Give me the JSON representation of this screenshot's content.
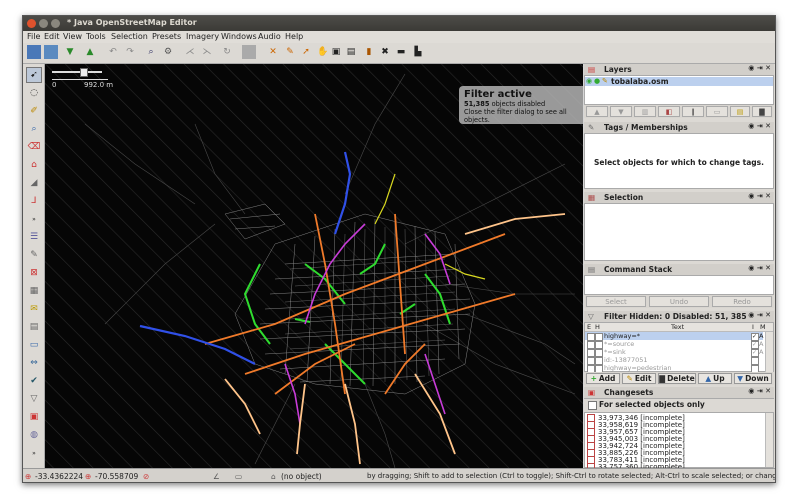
{
  "window_title": "* Java OpenStreetMap Editor",
  "menu": [
    "File",
    "Edit",
    "View",
    "Tools",
    "Selection",
    "Presets",
    "Imagery",
    "Windows",
    "Audio",
    "Help"
  ],
  "scale_label": "992.0 m",
  "scale_zero": "0",
  "filter_overlay": {
    "title": "Filter active",
    "count": "51,385",
    "line1_suffix": "objects disabled",
    "line2": "Close the filter dialog to see all objects."
  },
  "layers": {
    "title": "Layers",
    "items": [
      {
        "name": "tobalaba.osm"
      }
    ]
  },
  "tags": {
    "title": "Tags / Memberships",
    "hint": "Select objects for which to change tags."
  },
  "selection": {
    "title": "Selection"
  },
  "command_stack": {
    "title": "Command Stack",
    "buttons": [
      "Select",
      "Undo",
      "Redo"
    ]
  },
  "filter_panel": {
    "title": "Filter Hidden: 0 Disabled: 51, 385",
    "columns": [
      "E",
      "H",
      "Text",
      "I",
      "M"
    ],
    "rows": [
      {
        "text": "highway=*",
        "m": "A",
        "active": true
      },
      {
        "text": "*=source",
        "m": "A",
        "active": false
      },
      {
        "text": "*=sink",
        "m": "A",
        "active": false
      },
      {
        "text": "id:-13877051",
        "m": "",
        "active": false
      },
      {
        "text": "highway=pedestrian",
        "m": "",
        "active": false
      }
    ],
    "buttons": [
      "Add",
      "Edit",
      "Delete",
      "Up",
      "Down"
    ]
  },
  "changesets": {
    "title": "Changesets",
    "option": "For selected objects only",
    "items": [
      "33,973,346 [incomplete]",
      "33,958,619 [incomplete]",
      "33,957,657 [incomplete]",
      "33,945,003 [incomplete]",
      "33,942,724 [incomplete]",
      "33,885,226 [incomplete]",
      "33,783,411 [incomplete]",
      "33,757,360 [incomplete]"
    ]
  },
  "status": {
    "lat": "-33.4362224",
    "lon": "-70.558709",
    "selection": "(no object)",
    "help": "by dragging; Shift to add to selection (Ctrl to toggle); Shift-Ctrl to rotate selected; Alt-Ctrl to scale selected; or change selection"
  },
  "colors": {
    "accent_selection": "#bcd0ee",
    "map_background": "#000000"
  }
}
